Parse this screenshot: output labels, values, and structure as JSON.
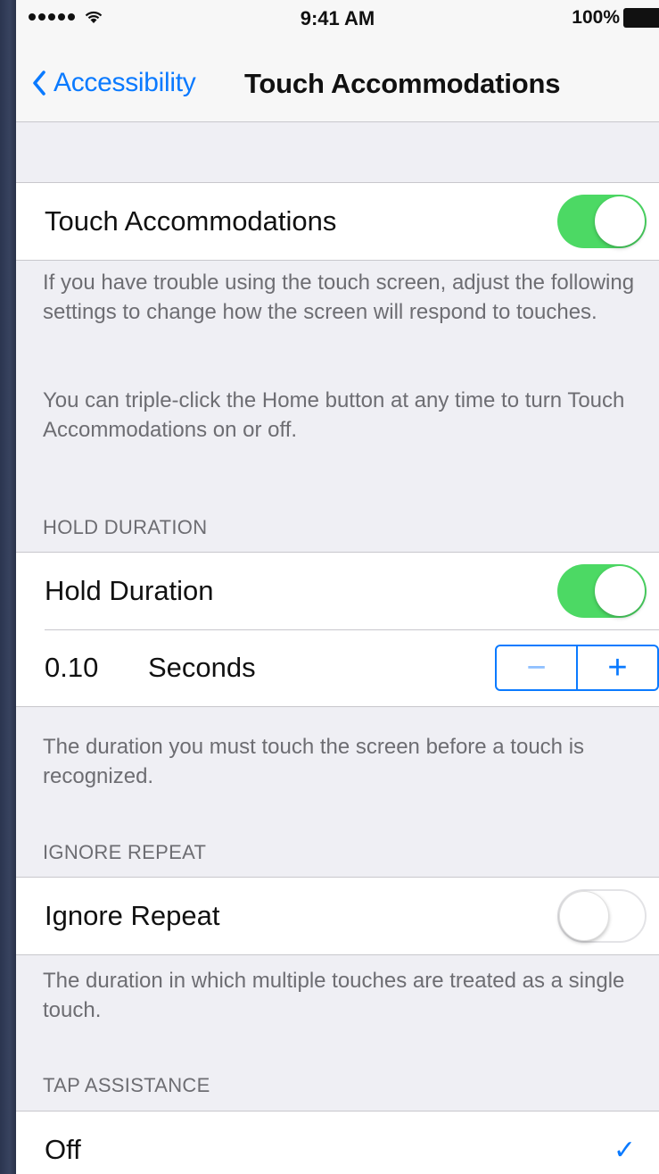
{
  "status_bar": {
    "time": "9:41 AM",
    "battery_percent": "100%",
    "signal_icon": "signal-dots-icon",
    "wifi_icon": "wifi-icon",
    "battery_icon": "battery-icon"
  },
  "nav": {
    "back_label": "Accessibility",
    "title": "Touch Accommodations"
  },
  "colors": {
    "accent": "#0a7aff",
    "toggle_on": "#4cd964",
    "background": "#efeff4",
    "footer_text": "#6d6d72"
  },
  "touch_accommodations": {
    "label": "Touch Accommodations",
    "enabled": true,
    "footer_1": "If you have trouble using the touch screen, adjust the following settings to change how the screen will respond to touches.",
    "footer_2": "You can triple-click the Home button at any time to turn Touch Accommodations on or off."
  },
  "hold_duration": {
    "header": "HOLD DURATION",
    "label": "Hold Duration",
    "enabled": true,
    "value": "0.10",
    "unit": "Seconds",
    "minus_label": "−",
    "plus_label": "+",
    "footer": "The duration you must touch the screen before a touch is recognized."
  },
  "ignore_repeat": {
    "header": "IGNORE REPEAT",
    "label": "Ignore Repeat",
    "enabled": false,
    "footer": "The duration in which multiple touches are treated as a single touch."
  },
  "tap_assistance": {
    "header": "TAP ASSISTANCE",
    "options": [
      {
        "label": "Off",
        "selected": true
      }
    ],
    "check": "✓"
  }
}
